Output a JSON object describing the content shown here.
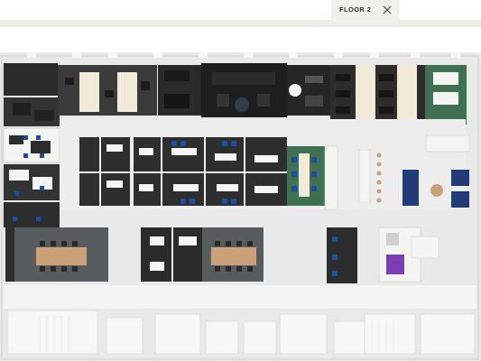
{
  "floor_tab": {
    "label": "FLOOR 2",
    "close_icon": "close-icon"
  },
  "colors": {
    "wall": "#e9e9e9",
    "wall_edge": "#cfcfcf",
    "carpet_dark": "#2b2b2b",
    "carpet_med": "#3b3b3b",
    "rug_grey": "#575c5f",
    "table_wood": "#c9a27a",
    "desk_white": "#f4f4f2",
    "chair_blue": "#1f4da3",
    "sofa_navy": "#203b78",
    "green_floor": "#3f7052",
    "purple_panel": "#7a3fb3",
    "sand_floor": "#f2ead8"
  }
}
